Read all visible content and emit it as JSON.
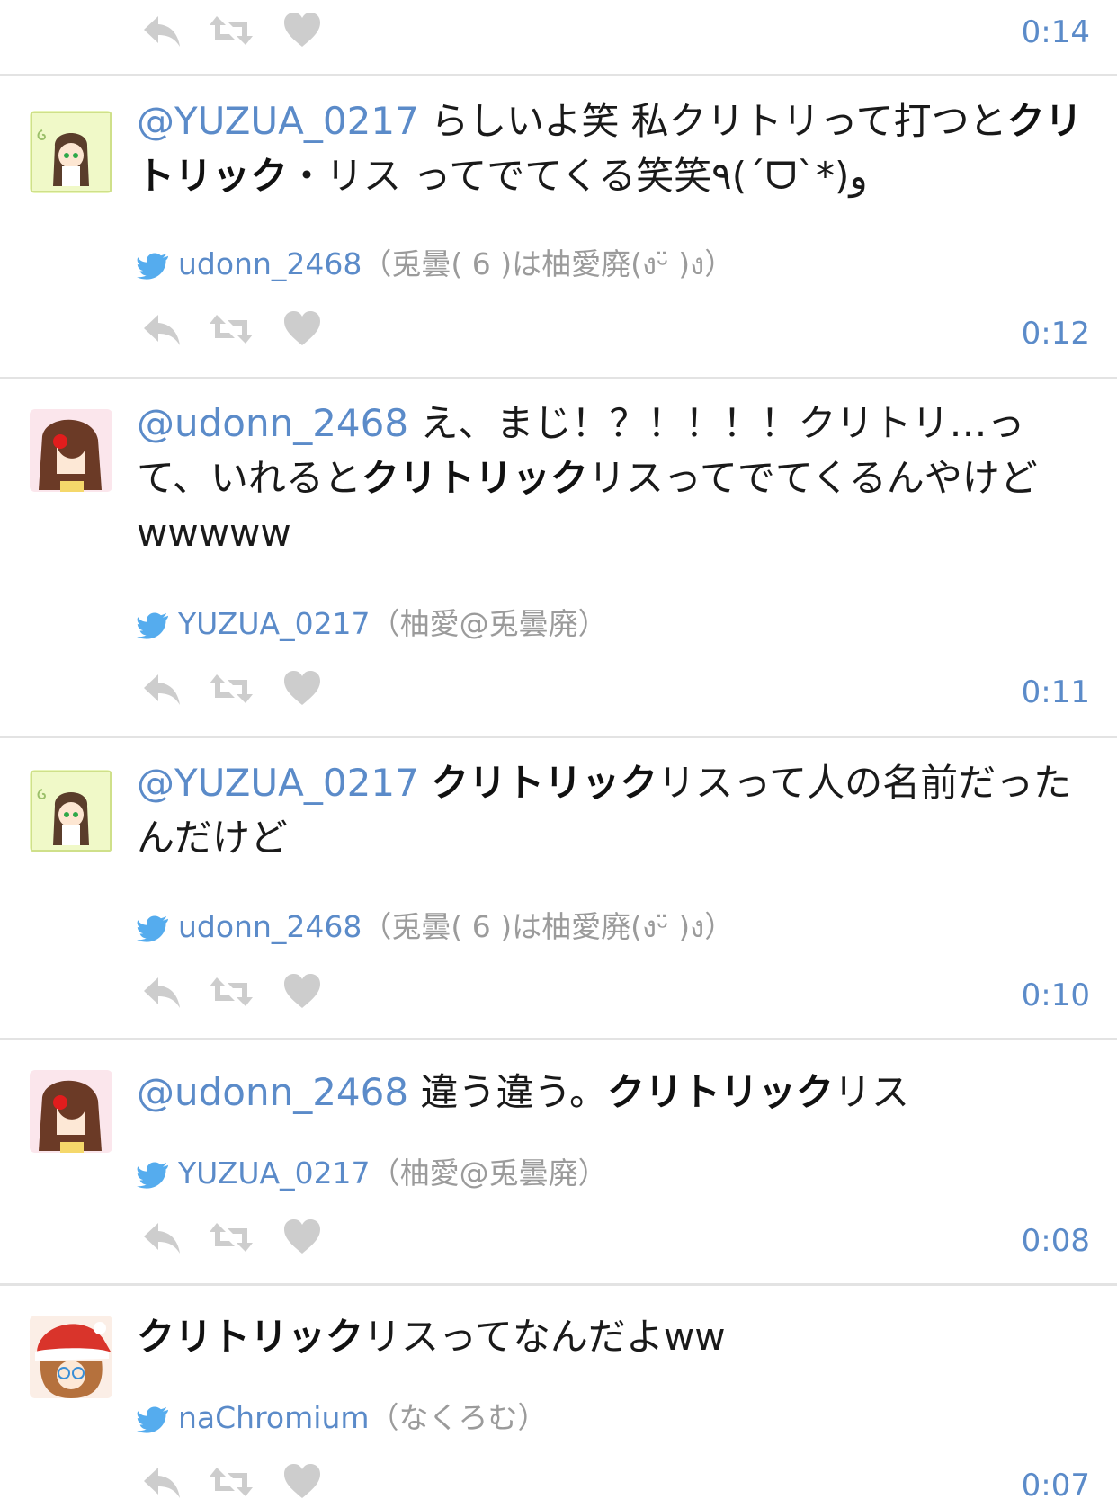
{
  "colors": {
    "link": "#5b8bc9",
    "meta_gray": "#9b9b9b",
    "icon_gray": "#cdcdcd",
    "divider": "#e3e3e3",
    "twitter_bird": "#55acee"
  },
  "icons": {
    "reply": "reply-arrow-icon",
    "retweet": "retweet-icon",
    "like": "heart-icon",
    "source": "twitter-bird-icon"
  },
  "tweets": [
    {
      "time": "0:14"
    },
    {
      "mention": "@YUZUA_0217",
      "text_parts": [
        "らしいよ笑 私クリトリって打つと",
        "クリトリック",
        "・リス ってでてくる笑笑٩(ˊᗜˋ*)و"
      ],
      "handle": "udonn_2468",
      "display_name": "（兎曇( 6 )は柚愛廃(งᵕ̈ )ง）",
      "time": "0:12"
    },
    {
      "mention": "@udonn_2468",
      "text_parts": [
        "え、まじ！？！！！！クリトリ…って、いれると",
        "クリトリック",
        "リスってでてくるんやけどwwwww"
      ],
      "handle": "YUZUA_0217",
      "display_name": "（柚愛@兎曇廃）",
      "time": "0:11"
    },
    {
      "mention": "@YUZUA_0217",
      "text_parts": [
        "",
        "クリトリック",
        "リスって人の名前だったんだけど"
      ],
      "handle": "udonn_2468",
      "display_name": "（兎曇( 6 )は柚愛廃(งᵕ̈ )ง）",
      "time": "0:10"
    },
    {
      "mention": "@udonn_2468",
      "text_parts": [
        "違う違う。",
        "クリトリック",
        "リス"
      ],
      "handle": "YUZUA_0217",
      "display_name": "（柚愛@兎曇廃）",
      "time": "0:08"
    },
    {
      "mention": "",
      "text_parts": [
        "",
        "クリトリック",
        "リスってなんだよww"
      ],
      "handle": "naChromium",
      "display_name": "（なくろむ）",
      "time": "0:07"
    }
  ]
}
